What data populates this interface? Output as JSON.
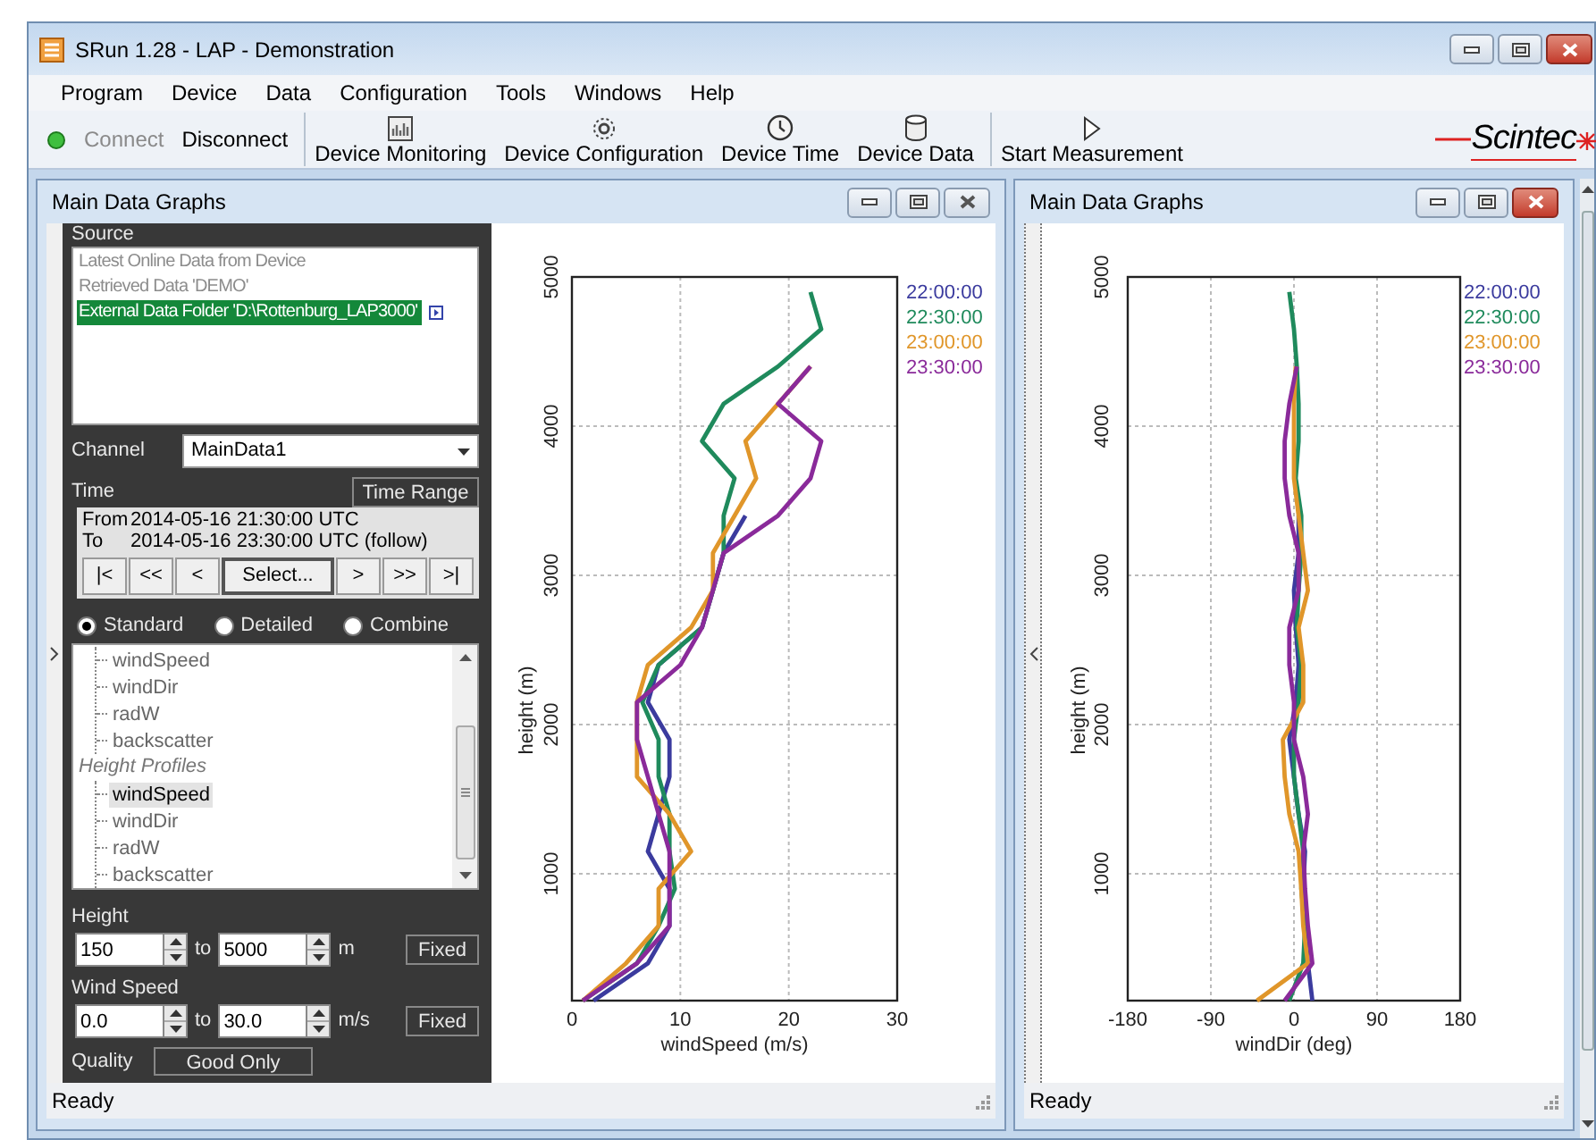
{
  "window": {
    "title": "SRun 1.28 - LAP - Demonstration",
    "active": true
  },
  "menu": [
    "Program",
    "Device",
    "Data",
    "Configuration",
    "Tools",
    "Windows",
    "Help"
  ],
  "toolbar": {
    "items": [
      {
        "kind": "text",
        "label": "Connect",
        "disabled": true,
        "separator_before": false
      },
      {
        "kind": "text",
        "label": "Disconnect",
        "disabled": false,
        "separator_before": false
      },
      {
        "kind": "monitor",
        "label": "Device Monitoring",
        "disabled": false,
        "separator_before": true
      },
      {
        "kind": "gear",
        "label": "Device Configuration",
        "disabled": false,
        "separator_before": false
      },
      {
        "kind": "clock",
        "label": "Device Time",
        "disabled": false,
        "separator_before": false
      },
      {
        "kind": "database",
        "label": "Device Data",
        "disabled": false,
        "separator_before": false
      },
      {
        "kind": "play",
        "label": "Start Measurement",
        "disabled": false,
        "separator_before": true
      }
    ],
    "logo": "Scintec"
  },
  "left_window": {
    "title": "Main Data Graphs",
    "active": false,
    "panel": {
      "source": {
        "label": "Source",
        "items": [
          {
            "label": "Latest Online Data from Device",
            "selected": false,
            "disabled": true
          },
          {
            "label": "Retrieved Data 'DEMO'",
            "selected": false,
            "disabled": true
          },
          {
            "label": "External Data Folder 'D:\\Rottenburg_LAP3000'",
            "selected": true,
            "disabled": false
          }
        ]
      },
      "channel": {
        "label": "Channel",
        "value": "MainData1"
      },
      "time": {
        "label": "Time",
        "range_button": "Time Range",
        "from_label": "From",
        "from": "2014-05-16 21:30:00 UTC",
        "to_label": "To",
        "to": "2014-05-16 23:30:00 UTC (follow)",
        "nav": [
          "|<",
          "<<",
          "<",
          "Select...",
          ">",
          ">>",
          ">|"
        ]
      },
      "modes": [
        {
          "label": "Standard",
          "selected": true
        },
        {
          "label": "Detailed",
          "selected": false
        },
        {
          "label": "Combine",
          "selected": false
        }
      ],
      "tree": [
        {
          "children": [
            {
              "label": "windSpeed",
              "selected": false
            },
            {
              "label": "windDir",
              "selected": false
            },
            {
              "label": "radW",
              "selected": false
            },
            {
              "label": "backscatter",
              "selected": false
            }
          ]
        },
        {
          "label": "Height Profiles",
          "children": [
            {
              "label": "windSpeed",
              "selected": true
            },
            {
              "label": "windDir",
              "selected": false
            },
            {
              "label": "radW",
              "selected": false
            },
            {
              "label": "backscatter",
              "selected": false
            }
          ]
        }
      ],
      "height": {
        "label": "Height",
        "from": "150",
        "to_label": "to",
        "to": "5000",
        "unit": "m",
        "button": "Fixed"
      },
      "wind_speed": {
        "label": "Wind Speed",
        "from": "0.0",
        "to_label": "to",
        "to": "30.0",
        "unit": "m/s",
        "button": "Fixed"
      },
      "quality": {
        "label": "Quality",
        "value": "Good Only"
      }
    },
    "chart_data": {
      "type": "line",
      "orientation": "horizontal",
      "xlabel": "windSpeed (m/s)",
      "ylabel": "height (m)",
      "grid": true,
      "x": [
        150,
        400,
        650,
        900,
        1150,
        1400,
        1650,
        1900,
        2150,
        2400,
        2650,
        2900,
        3150,
        3400,
        3650,
        3900,
        4150,
        4400,
        4650,
        4900
      ],
      "series": [
        {
          "name": "22:00:00",
          "color": "#3b3b9e",
          "values": [
            2,
            7,
            9,
            9,
            7,
            8,
            9,
            9,
            7,
            8,
            12,
            13,
            14,
            16,
            null,
            null,
            null,
            null,
            null,
            null
          ]
        },
        {
          "name": "22:30:00",
          "color": "#1f8a5c",
          "values": [
            1,
            6,
            8,
            9.5,
            9,
            9,
            8,
            8,
            6.5,
            8,
            12,
            13,
            14,
            14,
            15,
            12,
            14,
            19,
            23,
            22
          ]
        },
        {
          "name": "23:00:00",
          "color": "#e0962a",
          "values": [
            1,
            5,
            8,
            8,
            11,
            9,
            6,
            6,
            6,
            7,
            11,
            13,
            13,
            15,
            17,
            16,
            19,
            22,
            null,
            null
          ]
        },
        {
          "name": "23:30:00",
          "color": "#8a2a9a",
          "values": [
            1,
            6,
            9,
            9,
            9,
            8,
            7,
            6,
            6,
            10,
            12,
            13,
            14,
            19,
            22,
            23,
            19,
            22,
            null,
            null
          ]
        }
      ],
      "xlim": [
        0,
        30
      ],
      "ylim": [
        150,
        5000
      ],
      "xticks": [
        0,
        10,
        20,
        30
      ],
      "yticks": [
        1000,
        2000,
        3000,
        4000,
        5000
      ]
    },
    "status": "Ready"
  },
  "right_window": {
    "title": "Main Data Graphs",
    "active": true,
    "chart_data": {
      "type": "line",
      "orientation": "horizontal",
      "xlabel": "windDir (deg)",
      "ylabel": "height (m)",
      "grid": true,
      "x": [
        150,
        400,
        650,
        900,
        1150,
        1400,
        1650,
        1900,
        2150,
        2400,
        2650,
        2900,
        3150,
        3400,
        3650,
        3900,
        4150,
        4400,
        4650,
        4900
      ],
      "series": [
        {
          "name": "22:00:00",
          "color": "#3b3b9e",
          "values": [
            20,
            15,
            12,
            10,
            12,
            5,
            0,
            -5,
            2,
            5,
            2,
            0,
            5,
            5,
            null,
            null,
            null,
            null,
            null,
            null
          ]
        },
        {
          "name": "22:30:00",
          "color": "#1f8a5c",
          "values": [
            -5,
            10,
            12,
            8,
            10,
            5,
            0,
            0,
            5,
            8,
            3,
            5,
            8,
            8,
            2,
            5,
            5,
            3,
            0,
            -5
          ]
        },
        {
          "name": "23:00:00",
          "color": "#e0962a",
          "values": [
            -40,
            15,
            10,
            8,
            5,
            -5,
            -10,
            -12,
            10,
            10,
            5,
            15,
            10,
            5,
            0,
            0,
            0,
            2,
            null,
            null
          ]
        },
        {
          "name": "23:30:00",
          "color": "#8a2a9a",
          "values": [
            -10,
            20,
            15,
            12,
            10,
            15,
            10,
            0,
            0,
            -5,
            -5,
            5,
            5,
            -5,
            -10,
            -10,
            -5,
            3,
            null,
            null
          ]
        }
      ],
      "xlim": [
        -180,
        180
      ],
      "ylim": [
        150,
        5000
      ],
      "xticks": [
        -180,
        -90,
        0,
        90,
        180
      ],
      "yticks": [
        1000,
        2000,
        3000,
        4000,
        5000
      ]
    },
    "status": "Ready"
  }
}
